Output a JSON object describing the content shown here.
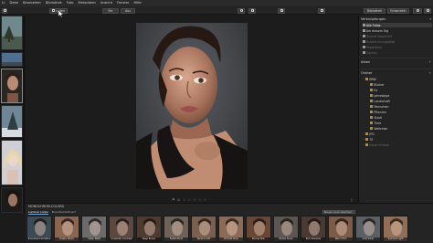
{
  "menubar": [
    "Lr",
    "Datei",
    "Bearbeiten",
    "Bibliothek",
    "Foto",
    "Metadaten",
    "Ansicht",
    "Fenster",
    "Hilfe"
  ],
  "toolbar": {
    "import_label": "Laden",
    "mode_left": "Ein",
    "mode_right": "Aus",
    "right_tab_1": "Bibliothek",
    "right_tab_2": "Entwickeln"
  },
  "right_panel": {
    "header_1": "Verknüpfungen",
    "shortcuts": [
      {
        "label": "Alle Fotos",
        "selected": true
      },
      {
        "label": "Am diesem Tag",
        "selected": false
      },
      {
        "label": "Zuletzt importiert",
        "selected": false
      },
      {
        "label": "Zuletzt hinzugefügt",
        "selected": false
      },
      {
        "label": "Papierkorb",
        "selected": false
      },
      {
        "label": "Suchen",
        "selected": false
      }
    ],
    "header_2": "Alben",
    "header_3": "Ordner",
    "folders": [
      {
        "label": "BRW",
        "level": 0
      },
      {
        "label": "Bücher",
        "level": 1
      },
      {
        "label": "Ex",
        "level": 1
      },
      {
        "label": "Jahrestage",
        "level": 1
      },
      {
        "label": "Landschaft",
        "level": 1
      },
      {
        "label": "Menschen",
        "level": 1
      },
      {
        "label": "Pflanzen",
        "level": 1
      },
      {
        "label": "Stadt",
        "level": 1
      },
      {
        "label": "Tiere",
        "level": 1
      },
      {
        "label": "Weltreise",
        "level": 1
      },
      {
        "label": "JPG",
        "level": 0
      },
      {
        "label": "Tif",
        "level": 0
      },
      {
        "label": "Neuer Ordner",
        "level": 0
      }
    ]
  },
  "presets": {
    "title": "MONOCHROM-COLORS",
    "tabs": [
      "Luminar Looks",
      "Benutzerdefiniert"
    ],
    "dropdown": "Neuen Look speichern",
    "items": [
      {
        "name": "B-Gradient Schatten",
        "color": "#3c4a55"
      },
      {
        "name": "Classic Warm",
        "color": "#8a6650"
      },
      {
        "name": "Clean B&W",
        "color": "#6b6b6b"
      },
      {
        "name": "Cinematic Contrast",
        "color": "#5b4840"
      },
      {
        "name": "Deep Brown",
        "color": "#4e3a30"
      },
      {
        "name": "Faded Mood",
        "color": "#6e6158"
      },
      {
        "name": "Neutral Soft",
        "color": "#7a5e4e"
      },
      {
        "name": "Portrait Glow",
        "color": "#8c6a58"
      },
      {
        "name": "Bronze Skin",
        "color": "#6a4636"
      },
      {
        "name": "Muted Tones",
        "color": "#5c5552"
      },
      {
        "name": "Rich Shadows",
        "color": "#4a3a33"
      },
      {
        "name": "Warm Film",
        "color": "#7d5b49"
      },
      {
        "name": "Cold Silver",
        "color": "#5a6066"
      },
      {
        "name": "Summer Light",
        "color": "#916e55"
      }
    ]
  },
  "midbar": {
    "stars": "☆ ☆ ☆ ☆ ☆"
  },
  "colors": {
    "accent": "#6fa8dc",
    "folder": "#b48a3c"
  }
}
